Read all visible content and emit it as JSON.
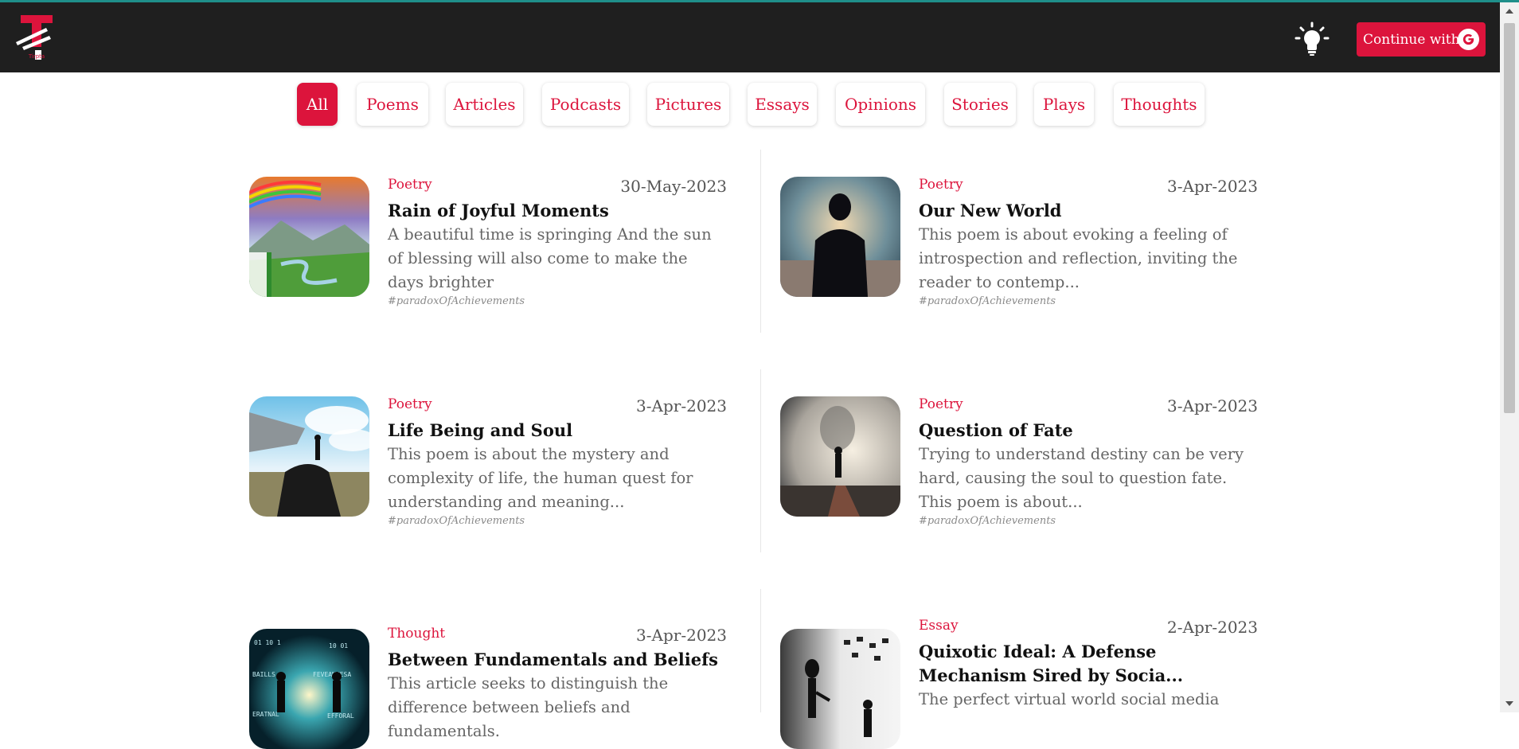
{
  "header": {
    "logo_text": "Tirpta",
    "continue_label": "Continue with",
    "google_icon": "google-g-icon",
    "theme_icon": "lightbulb-icon",
    "accent_color": "#dc143c",
    "bar_color": "#1f1f1f"
  },
  "filters": [
    {
      "label": "All",
      "active": true
    },
    {
      "label": "Poems",
      "active": false
    },
    {
      "label": "Articles",
      "active": false
    },
    {
      "label": "Podcasts",
      "active": false
    },
    {
      "label": "Pictures",
      "active": false
    },
    {
      "label": "Essays",
      "active": false
    },
    {
      "label": "Opinions",
      "active": false
    },
    {
      "label": "Stories",
      "active": false
    },
    {
      "label": "Plays",
      "active": false
    },
    {
      "label": "Thoughts",
      "active": false
    }
  ],
  "posts": [
    {
      "category": "Poetry",
      "date": "30-May-2023",
      "title": "Rain of Joyful Moments",
      "excerpt": "A beautiful time is springing And the sun of blessing will also come to make the days brighter",
      "tag": "#paradoxOfAchievements",
      "image": "rainbow-valley-image"
    },
    {
      "category": "Poetry",
      "date": "3-Apr-2023",
      "title": "Our New World",
      "excerpt": "This poem is about evoking a feeling of introspection and reflection, inviting the reader to contemp...",
      "tag": "#paradoxOfAchievements",
      "image": "silhouette-horizon-image"
    },
    {
      "category": "Poetry",
      "date": "3-Apr-2023",
      "title": "Life Being and Soul",
      "excerpt": "This poem is about the mystery and complexity of life, the human quest for understanding and meaning...",
      "tag": "#paradoxOfAchievements",
      "image": "man-on-rock-image"
    },
    {
      "category": "Poetry",
      "date": "3-Apr-2023",
      "title": "Question of Fate",
      "excerpt": "Trying to understand destiny can be very hard, causing the soul to question fate. This poem is about...",
      "tag": "#paradoxOfAchievements",
      "image": "misty-path-image"
    },
    {
      "category": "Thought",
      "date": "3-Apr-2023",
      "title": "Between Fundamentals and Beliefs",
      "excerpt": "This article seeks to distinguish the difference between beliefs and fundamentals.",
      "tag": "",
      "image": "code-figures-image"
    },
    {
      "category": "Essay",
      "date": "2-Apr-2023",
      "title": "Quixotic Ideal: A Defense Mechanism Sired by Socia...",
      "excerpt": "The perfect virtual world social media",
      "tag": "",
      "image": "robot-social-media-image"
    }
  ]
}
